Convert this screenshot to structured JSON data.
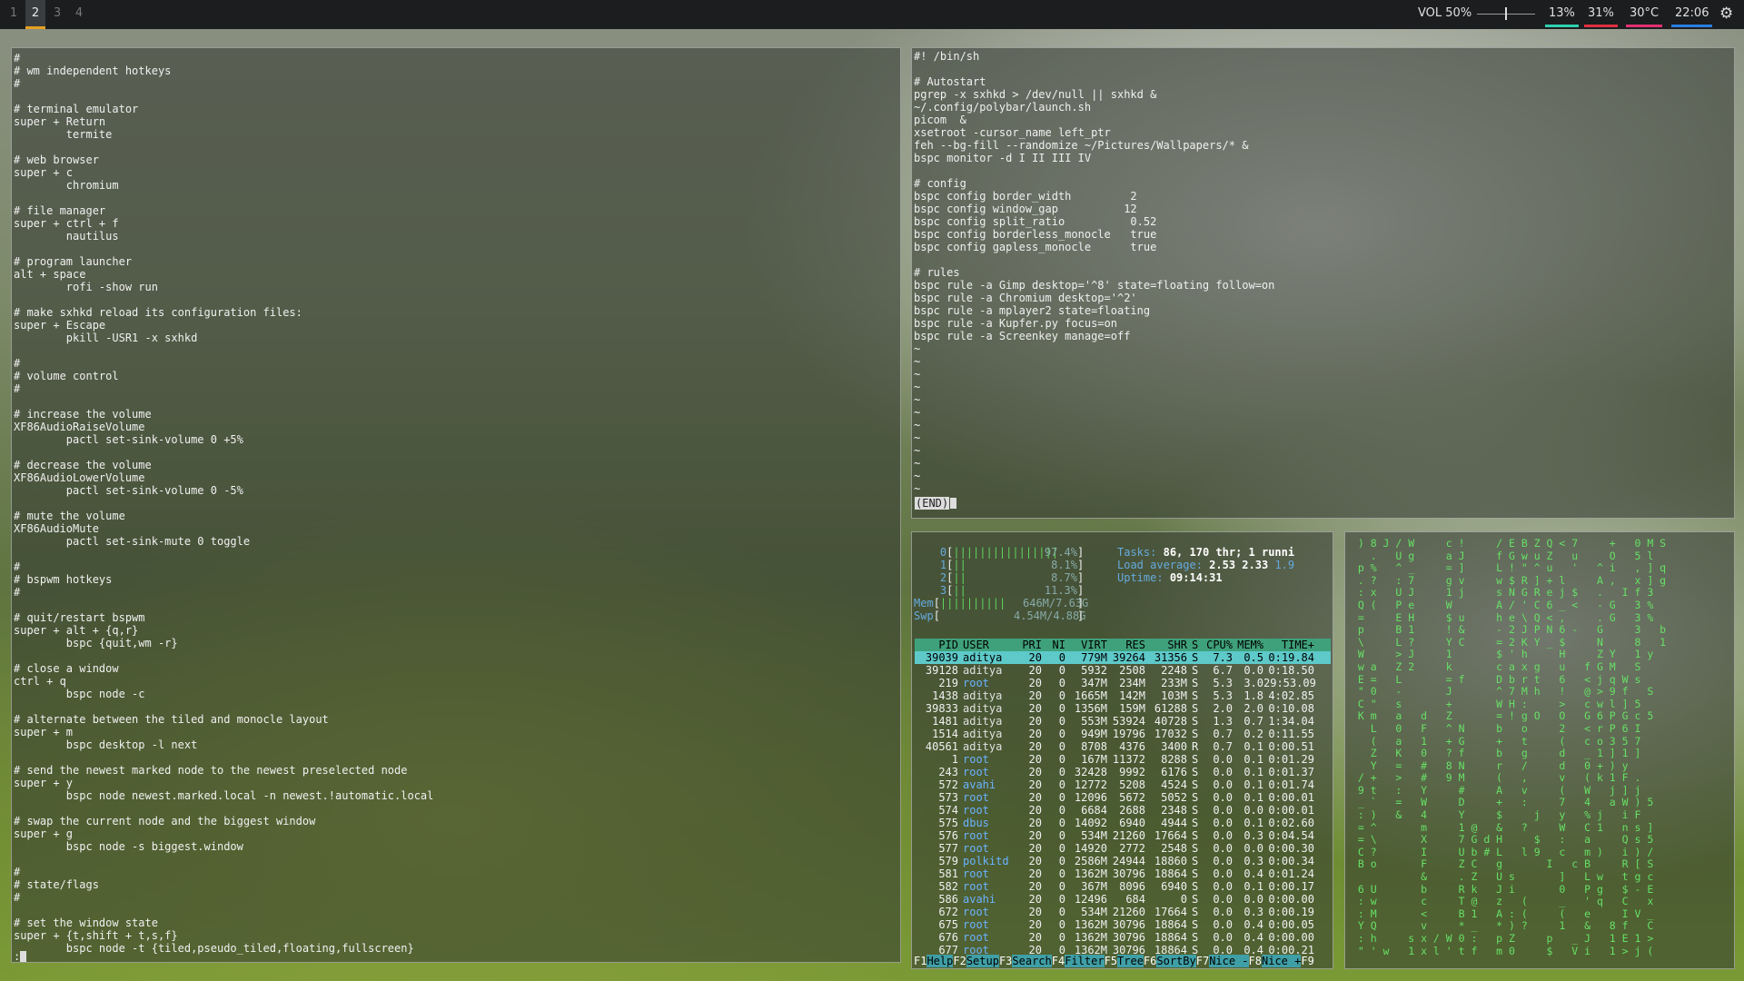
{
  "topbar": {
    "workspaces": [
      {
        "label": "1",
        "active": false
      },
      {
        "label": "2",
        "active": true
      },
      {
        "label": "3",
        "active": false
      },
      {
        "label": "4",
        "active": false
      }
    ],
    "volume": {
      "text": "VOL 50%",
      "level": 0.5
    },
    "modules": [
      {
        "text": "13%",
        "color": "#2fd0b0"
      },
      {
        "text": "31%",
        "color": "#e03040"
      },
      {
        "text": "30°C",
        "color": "#e03070"
      },
      {
        "text": "22:06",
        "color": "#2a7de0"
      }
    ],
    "settings_icon": "gear-icon"
  },
  "sxhkd_editor": {
    "lines": [
      "#",
      "# wm independent hotkeys",
      "#",
      "",
      "# terminal emulator",
      "super + Return",
      "        termite",
      "",
      "# web browser",
      "super + c",
      "        chromium",
      "",
      "# file manager",
      "super + ctrl + f",
      "        nautilus",
      "",
      "# program launcher",
      "alt + space",
      "        rofi -show run",
      "",
      "# make sxhkd reload its configuration files:",
      "super + Escape",
      "        pkill -USR1 -x sxhkd",
      "",
      "#",
      "# volume control",
      "#",
      "",
      "# increase the volume",
      "XF86AudioRaiseVolume",
      "        pactl set-sink-volume 0 +5%",
      "",
      "# decrease the volume",
      "XF86AudioLowerVolume",
      "        pactl set-sink-volume 0 -5%",
      "",
      "# mute the volume",
      "XF86AudioMute",
      "        pactl set-sink-mute 0 toggle",
      "",
      "#",
      "# bspwm hotkeys",
      "#",
      "",
      "# quit/restart bspwm",
      "super + alt + {q,r}",
      "        bspc {quit,wm -r}",
      "",
      "# close a window",
      "ctrl + q",
      "        bspc node -c",
      "",
      "# alternate between the tiled and monocle layout",
      "super + m",
      "        bspc desktop -l next",
      "",
      "# send the newest marked node to the newest preselected node",
      "super + y",
      "        bspc node newest.marked.local -n newest.!automatic.local",
      "",
      "# swap the current node and the biggest window",
      "super + g",
      "        bspc node -s biggest.window",
      "",
      "#",
      "# state/flags",
      "#",
      "",
      "# set the window state",
      "super + {t,shift + t,s,f}",
      "        bspc node -t {tiled,pseudo_tiled,floating,fullscreen}"
    ],
    "prompt": ":"
  },
  "bspwmrc_pager": {
    "lines": [
      "#! /bin/sh",
      "",
      "# Autostart",
      "pgrep -x sxhkd > /dev/null || sxhkd &",
      "~/.config/polybar/launch.sh",
      "picom  &",
      "xsetroot -cursor_name left_ptr",
      "feh --bg-fill --randomize ~/Pictures/Wallpapers/* &",
      "bspc monitor -d I II III IV",
      "",
      "# config",
      "bspc config border_width         2",
      "bspc config window_gap          12",
      "bspc config split_ratio          0.52",
      "bspc config borderless_monocle   true",
      "bspc config gapless_monocle      true",
      "",
      "# rules",
      "bspc rule -a Gimp desktop='^8' state=floating follow=on",
      "bspc rule -a Chromium desktop='^2'",
      "bspc rule -a mplayer2 state=floating",
      "bspc rule -a Kupfer.py focus=on",
      "bspc rule -a Screenkey manage=off",
      "~",
      "~",
      "~",
      "~",
      "~",
      "~",
      "~",
      "~",
      "~",
      "~",
      "~",
      "~"
    ],
    "end_marker": "(END)"
  },
  "htop": {
    "cpus": [
      {
        "id": "0",
        "bars": "||||||||||||||||",
        "pct": "97.4%"
      },
      {
        "id": "1",
        "bars": "||",
        "pct": "8.1%"
      },
      {
        "id": "2",
        "bars": "||",
        "pct": "8.7%"
      },
      {
        "id": "3",
        "bars": "||",
        "pct": "11.3%"
      }
    ],
    "mem": {
      "label": "Mem",
      "bars": "||||||||||",
      "value": "646M/7.63G"
    },
    "swp": {
      "label": "Swp",
      "bars": "",
      "value": "4.54M/4.88G"
    },
    "tasks_label": "Tasks:",
    "tasks_value": "86, 170 thr; 1 runni",
    "load_label": "Load average:",
    "load_1": "2.53",
    "load_5": "2.33",
    "load_15": "1.9",
    "uptime_label": "Uptime:",
    "uptime_value": "09:14:31",
    "columns": [
      "PID",
      "USER",
      "PRI",
      "NI",
      "VIRT",
      "RES",
      "SHR",
      "S",
      "CPU%",
      "MEM%",
      "TIME+"
    ],
    "rows": [
      [
        "39039",
        "aditya",
        "20",
        "0",
        "779M",
        "39264",
        "31356",
        "S",
        "7.3",
        "0.5",
        "0:19.84"
      ],
      [
        "39128",
        "aditya",
        "20",
        "0",
        "5932",
        "2508",
        "2248",
        "S",
        "6.7",
        "0.0",
        "0:18.50"
      ],
      [
        "219",
        "root",
        "20",
        "0",
        "347M",
        "234M",
        "233M",
        "S",
        "5.3",
        "3.0",
        "29:53.09"
      ],
      [
        "1438",
        "aditya",
        "20",
        "0",
        "1665M",
        "142M",
        "103M",
        "S",
        "5.3",
        "1.8",
        "4:02.85"
      ],
      [
        "39833",
        "aditya",
        "20",
        "0",
        "1356M",
        "159M",
        "61288",
        "S",
        "2.0",
        "2.0",
        "0:10.08"
      ],
      [
        "1481",
        "aditya",
        "20",
        "0",
        "553M",
        "53924",
        "40728",
        "S",
        "1.3",
        "0.7",
        "1:34.04"
      ],
      [
        "1514",
        "aditya",
        "20",
        "0",
        "949M",
        "19796",
        "17032",
        "S",
        "0.7",
        "0.2",
        "0:11.55"
      ],
      [
        "40561",
        "aditya",
        "20",
        "0",
        "8708",
        "4376",
        "3400",
        "R",
        "0.7",
        "0.1",
        "0:00.51"
      ],
      [
        "1",
        "root",
        "20",
        "0",
        "167M",
        "11372",
        "8288",
        "S",
        "0.0",
        "0.1",
        "0:01.29"
      ],
      [
        "243",
        "root",
        "20",
        "0",
        "32428",
        "9992",
        "6176",
        "S",
        "0.0",
        "0.1",
        "0:01.37"
      ],
      [
        "572",
        "avahi",
        "20",
        "0",
        "12772",
        "5208",
        "4524",
        "S",
        "0.0",
        "0.1",
        "0:01.74"
      ],
      [
        "573",
        "root",
        "20",
        "0",
        "12096",
        "5672",
        "5052",
        "S",
        "0.0",
        "0.1",
        "0:00.01"
      ],
      [
        "574",
        "root",
        "20",
        "0",
        "6684",
        "2688",
        "2348",
        "S",
        "0.0",
        "0.0",
        "0:00.01"
      ],
      [
        "575",
        "dbus",
        "20",
        "0",
        "14092",
        "6940",
        "4944",
        "S",
        "0.0",
        "0.1",
        "0:02.60"
      ],
      [
        "576",
        "root",
        "20",
        "0",
        "534M",
        "21260",
        "17664",
        "S",
        "0.0",
        "0.3",
        "0:04.54"
      ],
      [
        "577",
        "root",
        "20",
        "0",
        "14920",
        "2772",
        "2548",
        "S",
        "0.0",
        "0.0",
        "0:00.30"
      ],
      [
        "579",
        "polkitd",
        "20",
        "0",
        "2586M",
        "24944",
        "18860",
        "S",
        "0.0",
        "0.3",
        "0:00.34"
      ],
      [
        "581",
        "root",
        "20",
        "0",
        "1362M",
        "30796",
        "18864",
        "S",
        "0.0",
        "0.4",
        "0:01.24"
      ],
      [
        "582",
        "root",
        "20",
        "0",
        "367M",
        "8096",
        "6940",
        "S",
        "0.0",
        "0.1",
        "0:00.17"
      ],
      [
        "586",
        "avahi",
        "20",
        "0",
        "12496",
        "684",
        "0",
        "S",
        "0.0",
        "0.0",
        "0:00.00"
      ],
      [
        "672",
        "root",
        "20",
        "0",
        "534M",
        "21260",
        "17664",
        "S",
        "0.0",
        "0.3",
        "0:00.19"
      ],
      [
        "675",
        "root",
        "20",
        "0",
        "1362M",
        "30796",
        "18864",
        "S",
        "0.0",
        "0.4",
        "0:00.05"
      ],
      [
        "676",
        "root",
        "20",
        "0",
        "1362M",
        "30796",
        "18864",
        "S",
        "0.0",
        "0.4",
        "0:00.00"
      ],
      [
        "677",
        "root",
        "20",
        "0",
        "1362M",
        "30796",
        "18864",
        "S",
        "0.0",
        "0.4",
        "0:00.21"
      ]
    ],
    "fkeys": [
      {
        "key": "F1",
        "label": "Help"
      },
      {
        "key": "F2",
        "label": "Setup"
      },
      {
        "key": "F3",
        "label": "Search"
      },
      {
        "key": "F4",
        "label": "Filter"
      },
      {
        "key": "F5",
        "label": "Tree"
      },
      {
        "key": "F6",
        "label": "SortBy"
      },
      {
        "key": "F7",
        "label": "Nice -"
      },
      {
        "key": "F8",
        "label": "Nice +"
      },
      {
        "key": "F9",
        "label": ""
      }
    ]
  },
  "matrix": {
    "lines": [
      "  ) 8 J / W     c !     / E B Z Q < 7     +   0 M S  ",
      "    .   U g     a J     f G w u Z   u     O   5 l    ",
      "  p %   ^ _     = ]     L ! \" ^ u   '   ^ i   , ] q  ",
      "  . ?   : 7     g v     w $ R ] + l     A ,   x ] g  ",
      "  : x   U J     1 j     s N G R e j $   .   I f 3    ",
      "  Q (   P e     W       A / ' C 6 _ <   - G   3 %    ",
      "  =     E H     $ u     h e \\ Q < ,     . G   3 %    ",
      "  p     B 1     ! &     - 2 J P N 6 -   G     3   b  ",
      "  \\     L ?     Y C     = 2 K Y _ $     N     8   1  ",
      "  W     > J     1       $ ' h     H     Z Y   1 y    ",
      "  w a   Z 2     k       c a x g   u   f G M   S      ",
      "  E =   L       = f     D b r t   6   < j q W s      ",
      "  \" 0   -       J       ^ 7 M h   !   @ > 9 f   S    ",
      "  C \"   s       +       W H :     >   c w l ] 5      ",
      "  K m   a   d   Z       = ! g O   O   G 6 P G c 5    ",
      "    L   0   F   ^ N     b   o     2   < r P 6 I      ",
      "    (   a   1   + G     +   t     (   c o 3 5 7      ",
      "    Z   K   0   ? f     b   g     d   _ 1 ] 1 ]      ",
      "    Y   =   #   8 N     r   /     d   0 + ) y        ",
      "  / +   >   #   9 M     (   ,     v   ( k 1 F .      ",
      "  9 t   :   Y     #     A   v     (   W   j ] j      ",
      "  _ `   =   W     D     +   :     7   4   a W ) 5    ",
      "  : )   &   4     Y     $     j   y   % j   i F      ",
      "  = ^       m     1 @   &   ?     W   C 1   n s ]    ",
      "  = \\       X     7 G d H     $   :   a     Q s 5    ",
      "  C ?       I     U b # L   l 9   c   m )   i ) /    ",
      "  B o       F     Z C   g       I   c B     R [ S    ",
      "            &     . Z   U s       ]   L w   t g c    ",
      "  6 U       b     R k   J i       0   P g   $ - E    ",
      "  : w       c     T @   z   (     _   ' q   C   x    ",
      "  : M       <     B 1   A : (     (   e     I V _    ",
      "  Y Q       v     * _   * ) ?     1   &   8 f   C    ",
      "  : h     s x / W 0 :   p Z     p   _ J   1 E 1 >   ",
      "  \" ' w   1 x l ' t f   m 0     $   V i   1 > j (   "
    ]
  }
}
